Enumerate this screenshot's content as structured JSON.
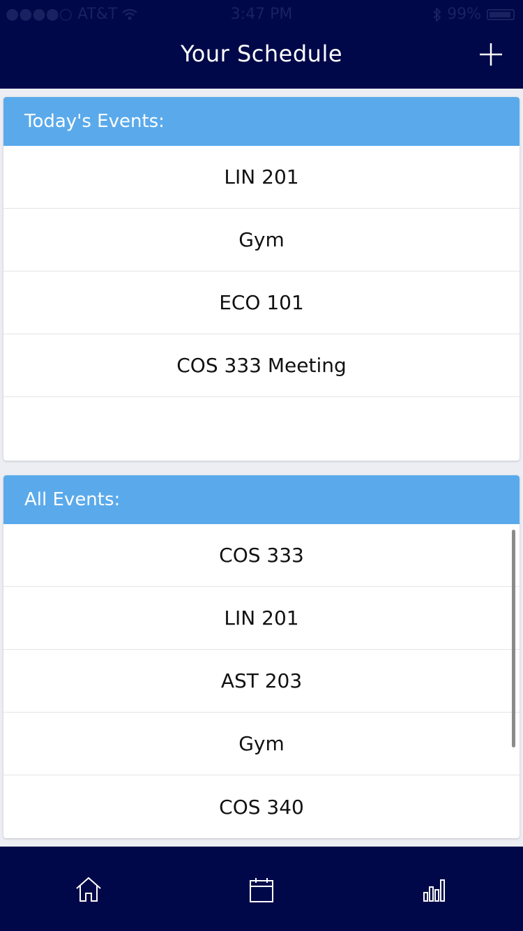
{
  "status_bar": {
    "carrier": "●●●●○ AT&T",
    "time": "3:47 PM",
    "battery": "99%"
  },
  "nav": {
    "title": "Your Schedule",
    "add_icon": "plus-icon"
  },
  "today": {
    "header": "Today's Events:",
    "items": [
      "LIN 201",
      "Gym",
      "ECO 101",
      "COS 333 Meeting",
      ""
    ]
  },
  "all": {
    "header": "All Events:",
    "items": [
      "COS 333",
      "LIN 201",
      "AST 203",
      "Gym",
      "COS 340"
    ]
  },
  "tabs": [
    {
      "icon": "home-icon"
    },
    {
      "icon": "calendar-icon"
    },
    {
      "icon": "bar-chart-icon"
    }
  ],
  "colors": {
    "nav_background": "#010849",
    "header_background": "#5aaaeb",
    "page_background": "#eceef3"
  }
}
